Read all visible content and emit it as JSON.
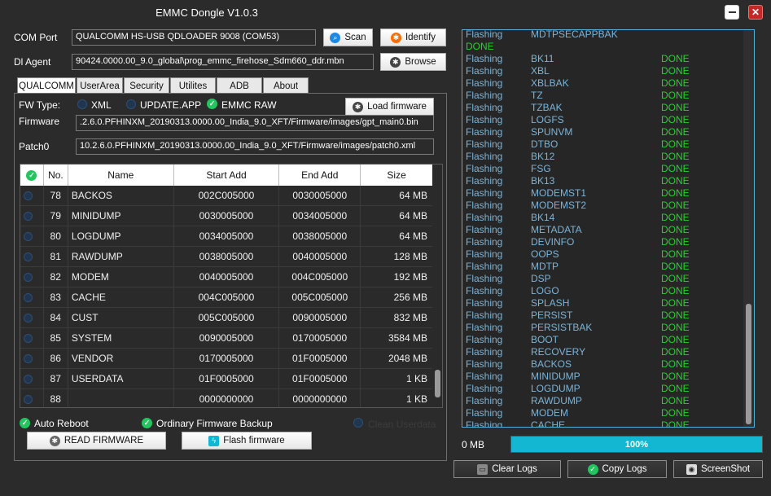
{
  "window": {
    "title": "EMMC Dongle V1.0.3"
  },
  "com_port": {
    "label": "COM Port",
    "value": "QUALCOMM HS-USB QDLOADER 9008 (COM53)"
  },
  "dl_agent": {
    "label": "Dl Agent",
    "value": "90424.0000.00_9.0_global\\prog_emmc_firehose_Sdm660_ddr.mbn"
  },
  "buttons": {
    "scan": "Scan",
    "identify": "Identify",
    "browse": "Browse",
    "load_firmware": "Load firmware",
    "read_firmware": "READ FIRMWARE",
    "flash_firmware": "Flash firmware",
    "clear_logs": "Clear Logs",
    "copy_logs": "Copy Logs",
    "screenshot": "ScreenShot"
  },
  "tabs": [
    "QUALCOMM",
    "UserArea",
    "Security",
    "Utilites",
    "ADB",
    "About"
  ],
  "fw_type": {
    "label": "FW Type:",
    "options": [
      "XML",
      "UPDATE.APP",
      "EMMC RAW"
    ],
    "selected": "EMMC RAW"
  },
  "firmware": {
    "label": "Firmware",
    "value": ".2.6.0.PFHINXM_20190313.0000.00_India_9.0_XFT/Firmware/images/gpt_main0.bin"
  },
  "patch0": {
    "label": "Patch0",
    "value": "10.2.6.0.PFHINXM_20190313.0000.00_India_9.0_XFT/Firmware/images/patch0.xml"
  },
  "table": {
    "headers": [
      "",
      "No.",
      "Name",
      "Start Add",
      "End Add",
      "Size"
    ],
    "rows": [
      {
        "no": "78",
        "name": "BACKOS",
        "start": "002C005000",
        "end": "0030005000",
        "size": "64 MB"
      },
      {
        "no": "79",
        "name": "MINIDUMP",
        "start": "0030005000",
        "end": "0034005000",
        "size": "64 MB"
      },
      {
        "no": "80",
        "name": "LOGDUMP",
        "start": "0034005000",
        "end": "0038005000",
        "size": "64 MB"
      },
      {
        "no": "81",
        "name": "RAWDUMP",
        "start": "0038005000",
        "end": "0040005000",
        "size": "128 MB"
      },
      {
        "no": "82",
        "name": "MODEM",
        "start": "0040005000",
        "end": "004C005000",
        "size": "192 MB"
      },
      {
        "no": "83",
        "name": "CACHE",
        "start": "004C005000",
        "end": "005C005000",
        "size": "256 MB"
      },
      {
        "no": "84",
        "name": "CUST",
        "start": "005C005000",
        "end": "0090005000",
        "size": "832 MB"
      },
      {
        "no": "85",
        "name": "SYSTEM",
        "start": "0090005000",
        "end": "0170005000",
        "size": "3584 MB"
      },
      {
        "no": "86",
        "name": "VENDOR",
        "start": "0170005000",
        "end": "01F0005000",
        "size": "2048 MB"
      },
      {
        "no": "87",
        "name": "USERDATA",
        "start": "01F0005000",
        "end": "01F0005000",
        "size": "1 KB"
      },
      {
        "no": "88",
        "name": "",
        "start": "0000000000",
        "end": "0000000000",
        "size": "1 KB"
      }
    ]
  },
  "options": {
    "auto_reboot": "Auto Reboot",
    "ordinary_backup": "Ordinary Firmware Backup",
    "clean_userdata": "Clean Userdata"
  },
  "log": {
    "first": {
      "a": "Flashing",
      "b": "MDTPSECAPPBAK"
    },
    "done_line": "DONE",
    "prefix": "Flashing",
    "status": "DONE",
    "items": [
      "BK11",
      "XBL",
      "XBLBAK",
      "TZ",
      "TZBAK",
      "LOGFS",
      "SPUNVM",
      "DTBO",
      "BK12",
      "FSG",
      "BK13",
      "MODEMST1",
      "MODEMST2",
      "BK14",
      "METADATA",
      "DEVINFO",
      "OOPS",
      "MDTP",
      "DSP",
      "LOGO",
      "SPLASH",
      "PERSIST",
      "PERSISTBAK",
      "BOOT",
      "RECOVERY",
      "BACKOS",
      "MINIDUMP",
      "LOGDUMP",
      "RAWDUMP",
      "MODEM",
      "CACHE"
    ]
  },
  "status": {
    "size": "0 MB",
    "progress_text": "100%",
    "progress": 1.0
  },
  "colors": {
    "accent": "#13b7d2",
    "done": "#22d32a",
    "log_text": "#7ab4d9",
    "check": "#22c55e",
    "identify_icon": "#ff6d00"
  },
  "icons": {
    "scan": "search-icon",
    "identify": "gear-icon",
    "browse": "star-icon",
    "load": "star-icon",
    "read": "gear-icon",
    "flash": "flash-icon",
    "clear": "eraser-icon",
    "copy": "check-icon",
    "screenshot": "camera-icon"
  }
}
